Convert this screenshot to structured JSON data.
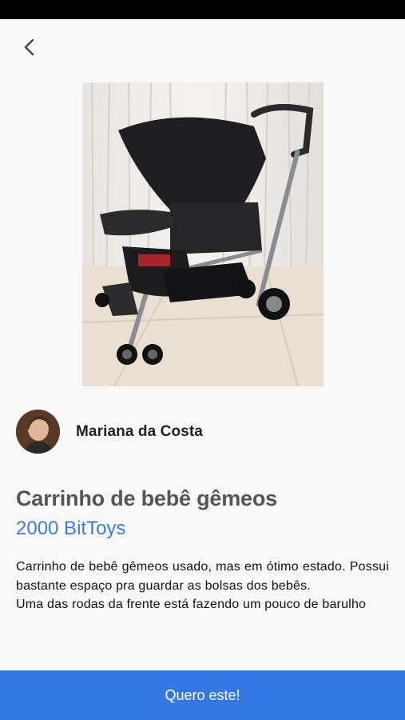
{
  "header": {
    "back_icon": "chevron-left-icon"
  },
  "product": {
    "image_icon": "stroller-photo",
    "title": "Carrinho de bebê gêmeos",
    "price": "2000 BitToys",
    "description": [
      "Carrinho de bebê gêmeos usado, mas em ótimo estado. Possui bastante espaço pra guardar as bolsas dos bebês.",
      "Uma das rodas da frente está fazendo um pouco de barulho"
    ]
  },
  "seller": {
    "name": "Mariana da Costa"
  },
  "actions": {
    "cta_label": "Quero este!"
  },
  "colors": {
    "accent": "#3478e5",
    "price": "#3a7bdc",
    "title": "#555555",
    "background": "#f9f9f9"
  }
}
